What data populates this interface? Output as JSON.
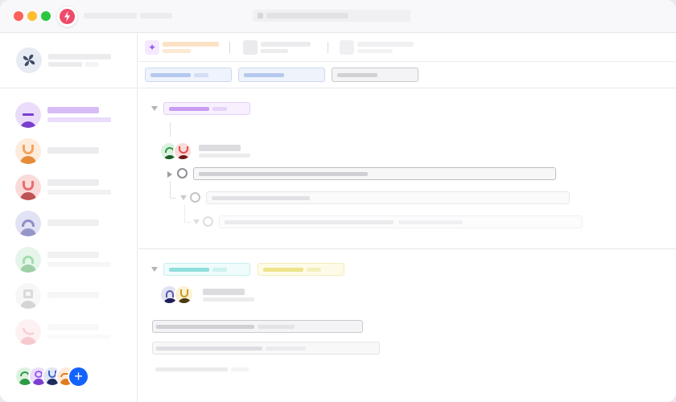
{
  "window": {
    "app_icon": "bolt-app-icon",
    "traffic_lights": {
      "close": "#fe5f57",
      "minimize": "#febc2e",
      "zoom": "#28c840"
    }
  },
  "sidebar": {
    "workspace_icon": "flower-logo-icon",
    "add_button_label": "+",
    "users": [
      {
        "id": "user-1",
        "color": "#7b3fd0",
        "bg": "#ebdcfb",
        "accent": "#b986ee",
        "active": true
      },
      {
        "id": "user-2",
        "color": "#e07b20",
        "bg": "#fdebdc",
        "accent": "#f2a460"
      },
      {
        "id": "user-3",
        "color": "#b33b3b",
        "bg": "#fbdada",
        "accent": "#e96d6d"
      },
      {
        "id": "user-4",
        "color": "#5a5aa6",
        "bg": "#e1e2f4",
        "accent": "#8d8ec8"
      },
      {
        "id": "user-5",
        "color": "#2e9a44",
        "bg": "#dcf2e0",
        "accent": "#7dd08e"
      },
      {
        "id": "user-6",
        "color": "#707070",
        "bg": "#eeeeee",
        "accent": "#bdbdbd"
      },
      {
        "id": "user-7",
        "color": "#e05260",
        "bg": "#fde2e5",
        "accent": "#f19aa4"
      }
    ]
  },
  "colors": {
    "accent_blue": "#1463ff",
    "tag_purple": "#c99cf2",
    "tag_teal": "#8fe0dd",
    "tag_yellow": "#eee48a",
    "chip_blue": "#b6c9ef"
  }
}
